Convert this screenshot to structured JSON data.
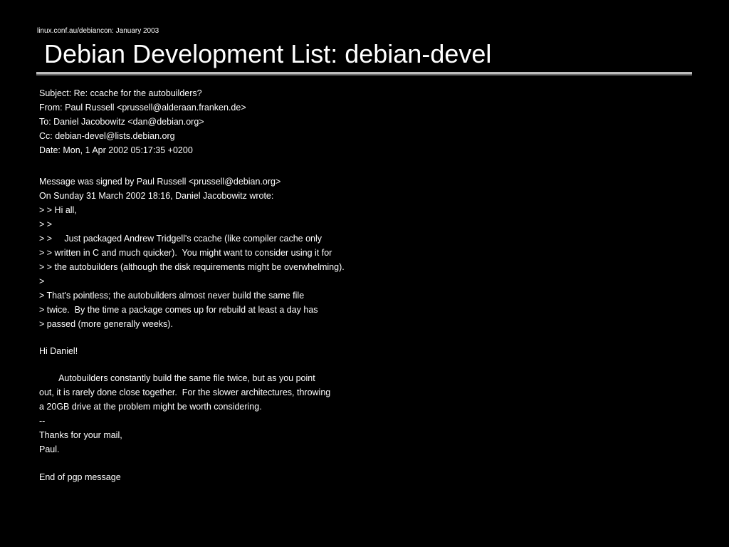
{
  "slide": {
    "tagline": "linux.conf.au/debiancon: January 2003",
    "title": "Debian Development List: debian-devel"
  },
  "headers": [
    "Subject: Re: ccache for the autobuilders?",
    "From: Paul Russell <prussell@alderaan.franken.de>",
    "To: Daniel Jacobowitz <dan@debian.org>",
    "Cc: debian-devel@lists.debian.org",
    "Date: Mon, 1 Apr 2002 05:17:35 +0200"
  ],
  "quote_block": [
    "Message was signed by Paul Russell <prussell@debian.org>",
    "On Sunday 31 March 2002 18:16, Daniel Jacobowitz wrote:",
    "> > Hi all,",
    "> >",
    "> >     Just packaged Andrew Tridgell's ccache (like compiler cache only",
    "> > written in C and much quicker).  You might want to consider using it for",
    "> > the autobuilders (although the disk requirements might be overwhelming).",
    ">",
    "> That's pointless; the autobuilders almost never build the same file",
    "> twice.  By the time a package comes up for rebuild at least a day has",
    "> passed (more generally weeks)."
  ],
  "greeting": "Hi Daniel!",
  "reply": [
    "        Autobuilders constantly build the same file twice, but as you point",
    "out, it is rarely done close together.  For the slower architectures, throwing",
    "a 20GB drive at the problem might be worth considering.",
    "--",
    "Thanks for your mail,",
    "Paul."
  ],
  "footer": "End of pgp message"
}
